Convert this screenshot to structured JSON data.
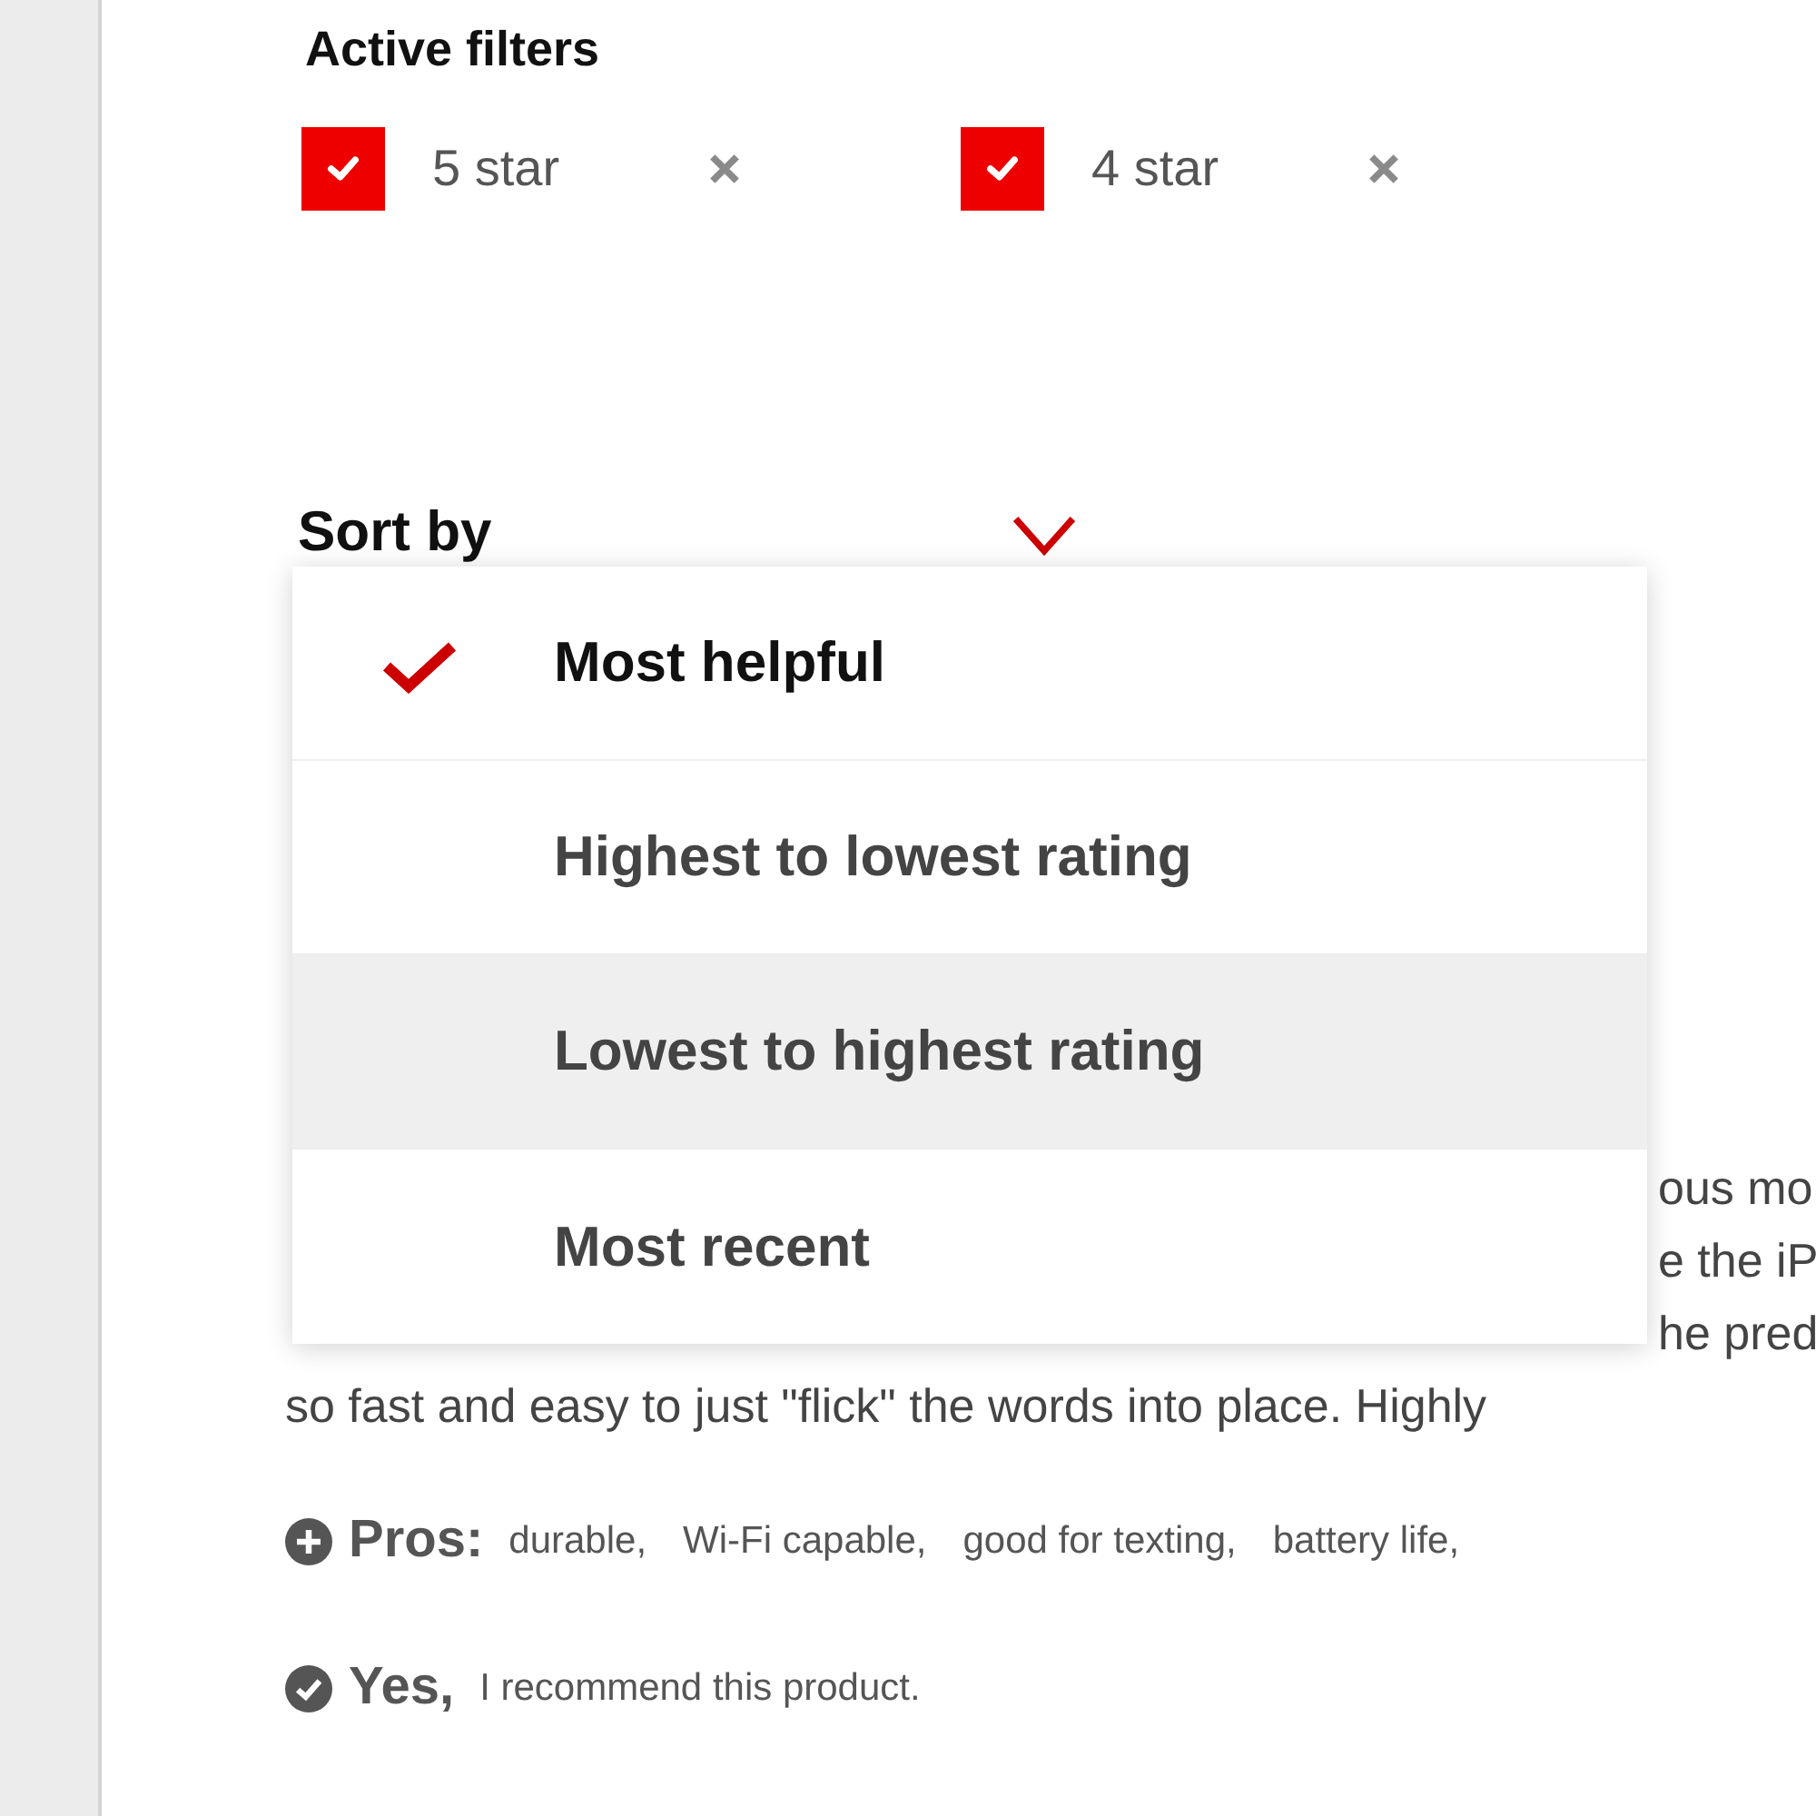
{
  "filters": {
    "title": "Active filters",
    "items": [
      {
        "label": "5 star",
        "checked": true
      },
      {
        "label": "4 star",
        "checked": true
      }
    ]
  },
  "sort": {
    "label": "Sort by",
    "expanded": true,
    "options": [
      {
        "label": "Most helpful",
        "selected": true,
        "hovered": false
      },
      {
        "label": "Highest to lowest rating",
        "selected": false,
        "hovered": false
      },
      {
        "label": "Lowest to highest rating",
        "selected": false,
        "hovered": true
      },
      {
        "label": "Most recent",
        "selected": false,
        "hovered": false
      }
    ]
  },
  "review": {
    "line_fragments": [
      "ous mo",
      "e the iP",
      "he pred"
    ],
    "last_line": "so fast and easy to just \"flick\" the words into place. Highly",
    "pros": {
      "label": "Pros:",
      "tags": [
        "durable,",
        "Wi-Fi capable,",
        "good for texting,",
        "battery life,"
      ]
    },
    "recommend": {
      "label": "Yes,",
      "text": "I recommend this product."
    }
  }
}
